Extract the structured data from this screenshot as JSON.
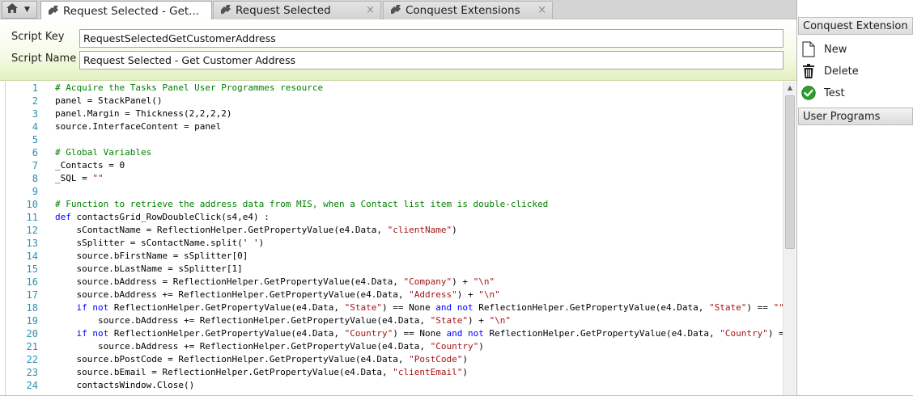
{
  "tabs": {
    "home_icon": "home-icon",
    "items": [
      {
        "label": "Request Selected - Get...",
        "active": true,
        "icon": "puzzle-icon"
      },
      {
        "label": "Request Selected",
        "active": false,
        "icon": "puzzle-icon"
      },
      {
        "label": "Conquest Extensions",
        "active": false,
        "icon": "puzzle-icon"
      }
    ],
    "close_glyph": "×"
  },
  "form": {
    "script_key_label": "Script Key",
    "script_key_value": "RequestSelectedGetCustomerAddress",
    "script_name_label": "Script Name",
    "script_name_value": "Request Selected - Get Customer Address"
  },
  "code": {
    "lines": [
      {
        "n": "1",
        "tokens": [
          {
            "t": "comment",
            "v": "# Acquire the Tasks Panel User Programmes resource"
          }
        ]
      },
      {
        "n": "2",
        "tokens": [
          {
            "t": "plain",
            "v": "panel = StackPanel()"
          }
        ]
      },
      {
        "n": "3",
        "tokens": [
          {
            "t": "plain",
            "v": "panel.Margin = Thickness(2,2,2,2)"
          }
        ]
      },
      {
        "n": "4",
        "tokens": [
          {
            "t": "plain",
            "v": "source.InterfaceContent = panel"
          }
        ]
      },
      {
        "n": "5",
        "tokens": []
      },
      {
        "n": "6",
        "tokens": [
          {
            "t": "comment",
            "v": "# Global Variables"
          }
        ]
      },
      {
        "n": "7",
        "tokens": [
          {
            "t": "plain",
            "v": "_Contacts = 0"
          }
        ]
      },
      {
        "n": "8",
        "tokens": [
          {
            "t": "plain",
            "v": "_SQL = "
          },
          {
            "t": "str",
            "v": "\"\""
          }
        ]
      },
      {
        "n": "9",
        "tokens": []
      },
      {
        "n": "10",
        "tokens": [
          {
            "t": "comment",
            "v": "# Function to retrieve the address data from MIS, when a Contact list item is double-clicked"
          }
        ]
      },
      {
        "n": "11",
        "tokens": [
          {
            "t": "kw",
            "v": "def"
          },
          {
            "t": "plain",
            "v": " contactsGrid_RowDoubleClick(s4,e4) :"
          }
        ]
      },
      {
        "n": "12",
        "tokens": [
          {
            "t": "plain",
            "v": "    sContactName = ReflectionHelper.GetPropertyValue(e4.Data, "
          },
          {
            "t": "str",
            "v": "\"clientName\""
          },
          {
            "t": "plain",
            "v": ")"
          }
        ]
      },
      {
        "n": "13",
        "tokens": [
          {
            "t": "plain",
            "v": "    sSplitter = sContactName.split(' ')"
          }
        ]
      },
      {
        "n": "14",
        "tokens": [
          {
            "t": "plain",
            "v": "    source.bFirstName = sSplitter[0]"
          }
        ]
      },
      {
        "n": "15",
        "tokens": [
          {
            "t": "plain",
            "v": "    source.bLastName = sSplitter[1]"
          }
        ]
      },
      {
        "n": "16",
        "tokens": [
          {
            "t": "plain",
            "v": "    source.bAddress = ReflectionHelper.GetPropertyValue(e4.Data, "
          },
          {
            "t": "str",
            "v": "\"Company\""
          },
          {
            "t": "plain",
            "v": ") + "
          },
          {
            "t": "str",
            "v": "\"\\n\""
          }
        ]
      },
      {
        "n": "17",
        "tokens": [
          {
            "t": "plain",
            "v": "    source.bAddress += ReflectionHelper.GetPropertyValue(e4.Data, "
          },
          {
            "t": "str",
            "v": "\"Address\""
          },
          {
            "t": "plain",
            "v": ") + "
          },
          {
            "t": "str",
            "v": "\"\\n\""
          }
        ]
      },
      {
        "n": "18",
        "tokens": [
          {
            "t": "kw",
            "v": "    if not"
          },
          {
            "t": "plain",
            "v": " ReflectionHelper.GetPropertyValue(e4.Data, "
          },
          {
            "t": "str",
            "v": "\"State\""
          },
          {
            "t": "plain",
            "v": ") == None "
          },
          {
            "t": "kw",
            "v": "and not"
          },
          {
            "t": "plain",
            "v": " ReflectionHelper.GetPropertyValue(e4.Data, "
          },
          {
            "t": "str",
            "v": "\"State\""
          },
          {
            "t": "plain",
            "v": ") == "
          },
          {
            "t": "str",
            "v": "\"\""
          }
        ]
      },
      {
        "n": "19",
        "tokens": [
          {
            "t": "plain",
            "v": "        source.bAddress += ReflectionHelper.GetPropertyValue(e4.Data, "
          },
          {
            "t": "str",
            "v": "\"State\""
          },
          {
            "t": "plain",
            "v": ") + "
          },
          {
            "t": "str",
            "v": "\"\\n\""
          }
        ]
      },
      {
        "n": "20",
        "tokens": [
          {
            "t": "kw",
            "v": "    if not"
          },
          {
            "t": "plain",
            "v": " ReflectionHelper.GetPropertyValue(e4.Data, "
          },
          {
            "t": "str",
            "v": "\"Country\""
          },
          {
            "t": "plain",
            "v": ") == None "
          },
          {
            "t": "kw",
            "v": "and not"
          },
          {
            "t": "plain",
            "v": " ReflectionHelper.GetPropertyValue(e4.Data, "
          },
          {
            "t": "str",
            "v": "\"Country\""
          },
          {
            "t": "plain",
            "v": ") ="
          }
        ]
      },
      {
        "n": "21",
        "tokens": [
          {
            "t": "plain",
            "v": "        source.bAddress += ReflectionHelper.GetPropertyValue(e4.Data, "
          },
          {
            "t": "str",
            "v": "\"Country\""
          },
          {
            "t": "plain",
            "v": ")"
          }
        ]
      },
      {
        "n": "22",
        "tokens": [
          {
            "t": "plain",
            "v": "    source.bPostCode = ReflectionHelper.GetPropertyValue(e4.Data, "
          },
          {
            "t": "str",
            "v": "\"PostCode\""
          },
          {
            "t": "plain",
            "v": ")"
          }
        ]
      },
      {
        "n": "23",
        "tokens": [
          {
            "t": "plain",
            "v": "    source.bEmail = ReflectionHelper.GetPropertyValue(e4.Data, "
          },
          {
            "t": "str",
            "v": "\"clientEmail\""
          },
          {
            "t": "plain",
            "v": ")"
          }
        ]
      },
      {
        "n": "24",
        "tokens": [
          {
            "t": "plain",
            "v": "    contactsWindow.Close()"
          }
        ]
      }
    ]
  },
  "panel": {
    "section1_title": "Conquest Extension",
    "actions": [
      {
        "label": "New",
        "icon": "new-document-icon"
      },
      {
        "label": "Delete",
        "icon": "trash-icon"
      },
      {
        "label": "Test",
        "icon": "check-circle-icon"
      }
    ],
    "section2_title": "User Programs"
  },
  "colors": {
    "comment": "#008000",
    "keyword": "#0000ff",
    "string": "#a31515",
    "line_number": "#2b91af",
    "header_gradient_end": "#e3f1c1"
  }
}
